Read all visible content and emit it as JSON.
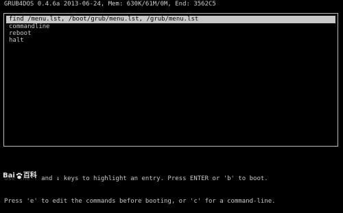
{
  "header": {
    "text": "GRUB4DOS 0.4.6a 2013-06-24, Mem: 630K/61M/0M, End: 3562C5"
  },
  "menu": {
    "items": [
      {
        "label": "find /menu.lst, /boot/grub/menu.lst, /grub/menu.lst",
        "selected": true
      },
      {
        "label": "commandline",
        "selected": false
      },
      {
        "label": "reboot",
        "selected": false
      },
      {
        "label": "halt",
        "selected": false
      }
    ]
  },
  "help": {
    "line1": "Use the ↑ and ↓ keys to highlight an entry. Press ENTER or 'b' to boot.",
    "line2": "Press 'e' to edit the commands before booting, or 'c' for a command-line."
  },
  "watermark": {
    "text_left": "Bai",
    "text_right": "百科"
  }
}
